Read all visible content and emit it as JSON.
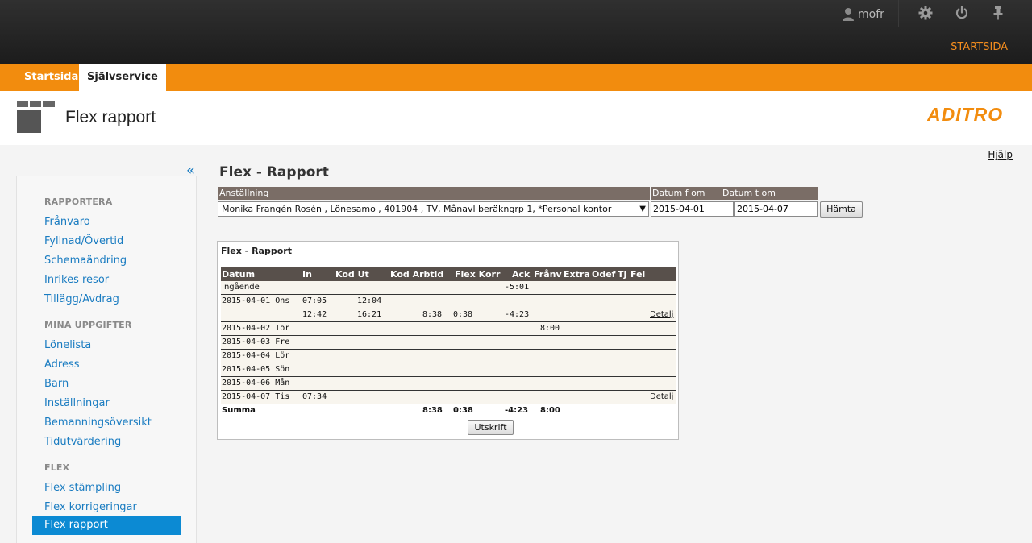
{
  "topbar": {
    "user": "mofr",
    "link": "STARTSIDA"
  },
  "tabs": [
    {
      "label": "Startsida"
    },
    {
      "label": "Självservice"
    }
  ],
  "page": {
    "title": "Flex rapport",
    "logo": "ADITRO",
    "help": "Hjälp",
    "collapse": "«"
  },
  "sidebar": {
    "sections": [
      {
        "title": "RAPPORTERA",
        "items": [
          "Frånvaro",
          "Fyllnad/Övertid",
          "Schemaändring",
          "Inrikes resor",
          "Tillägg/Avdrag"
        ]
      },
      {
        "title": "MINA UPPGIFTER",
        "items": [
          "Lönelista",
          "Adress",
          "Barn",
          "Inställningar",
          "Bemanningsöversikt",
          "Tidutvärdering"
        ]
      },
      {
        "title": "FLEX",
        "items": [
          "Flex stämpling",
          "Flex korrigeringar",
          "Flex rapport"
        ]
      }
    ],
    "active": "Flex rapport"
  },
  "main": {
    "title": "Flex - Rapport",
    "form": {
      "employment_label": "Anställning",
      "employment_value": "Monika Frangén Rosén , Lönesamo , 401904 , TV, Månavl beräkngrp 1, *Personal kontor",
      "date_from_label": "Datum f om",
      "date_to_label": "Datum t om",
      "date_from": "2015-04-01",
      "date_to": "2015-04-07",
      "fetch_button": "Hämta"
    },
    "report": {
      "title": "Flex - Rapport",
      "columns": [
        "Datum",
        "In",
        "Kod Ut",
        "Kod Arbtid",
        "Flex Korr",
        "Ack",
        "Frånv",
        "Extra",
        "Odef",
        "Tj",
        "Fel"
      ],
      "rows": [
        {
          "datum": "Ingående",
          "ack": "-5:01"
        },
        {
          "datum": "2015-04-01 Ons",
          "in": "07:05",
          "ut": "12:04"
        },
        {
          "in": "12:42",
          "ut": "16:21",
          "arbtid": "8:38",
          "flex": "0:38",
          "ack": "-4:23",
          "link": "Detalj"
        },
        {
          "datum": "2015-04-02 Tor",
          "franv": "8:00"
        },
        {
          "datum": "2015-04-03 Fre"
        },
        {
          "datum": "2015-04-04 Lör"
        },
        {
          "datum": "2015-04-05 Sön"
        },
        {
          "datum": "2015-04-06 Mån"
        },
        {
          "datum": "2015-04-07 Tis",
          "in": "07:34",
          "link": "Detalj"
        }
      ],
      "summary": {
        "label": "Summa",
        "arbtid": "8:38",
        "flex": "0:38",
        "ack": "-4:23",
        "franv": "8:00"
      },
      "print_button": "Utskrift"
    }
  },
  "colors": {
    "orange": "#f28c0e",
    "link": "#1a7cc1",
    "active": "#0c8ad3",
    "header": "#58504b"
  }
}
